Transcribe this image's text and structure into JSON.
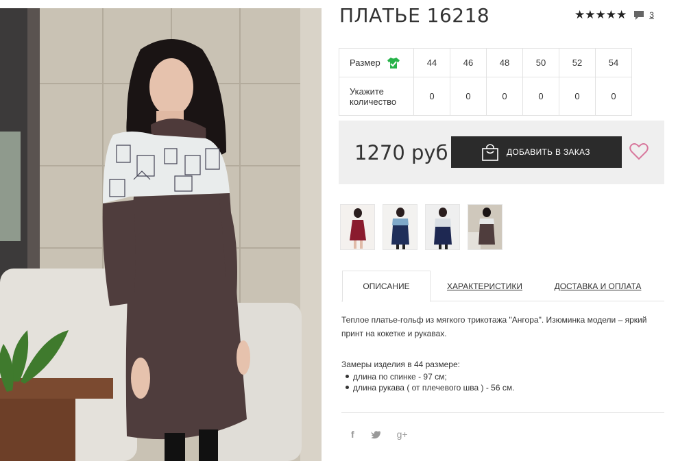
{
  "product": {
    "title": "ПЛАТЬЕ 16218",
    "stars": "★★★★★",
    "review_count": "3",
    "rating_icon": "star-icon",
    "comment_icon": "speech-bubble-icon"
  },
  "size_table": {
    "size_label": "Размер",
    "size_icon": "t-shirt-check-icon",
    "sizes": [
      "44",
      "46",
      "48",
      "50",
      "52",
      "54"
    ],
    "qty_label_line1": "Укажите",
    "qty_label_line2": "количество",
    "quantities": [
      "0",
      "0",
      "0",
      "0",
      "0",
      "0"
    ]
  },
  "purchase": {
    "price": "1270 руб",
    "order_button": "ДОБАВИТЬ В ЗАКАЗ",
    "bag_icon": "shopping-bag-icon",
    "wishlist_icon": "heart-icon",
    "accent_color": "#d8779c"
  },
  "tabs": {
    "description": "ОПИСАНИЕ",
    "characteristics": "ХАРАКТЕРИСТИКИ",
    "delivery": "ДОСТАВКА И ОПЛАТА"
  },
  "description": {
    "text": "Теплое платье-гольф из мягкого трикотажа \"Ангора\". Изюминка модели – яркий принт на кокетке и рукавах.",
    "measures_title": "Замеры изделия в 44 размере:",
    "measures": [
      "длина по спинке - 97 см;",
      "длина рукава ( от плечевого шва ) - 56 см."
    ]
  },
  "social": {
    "facebook": "f",
    "twitter": "twitter-bird-icon",
    "google_plus": "g+"
  }
}
